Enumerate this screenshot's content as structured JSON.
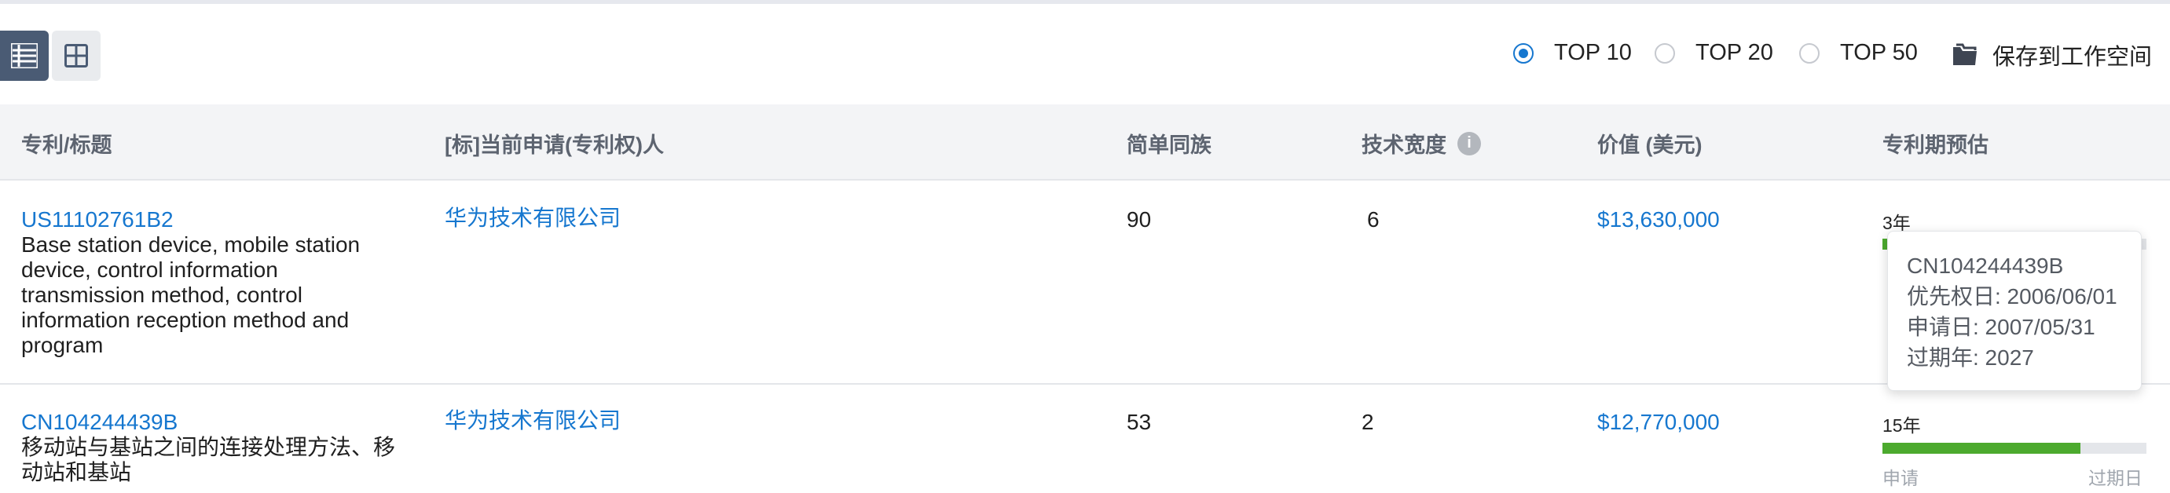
{
  "toolbar": {
    "view_list_icon": "list-view-icon",
    "view_grid_icon": "grid-view-icon",
    "top_options": [
      {
        "label": "TOP 10",
        "selected": true
      },
      {
        "label": "TOP 20",
        "selected": false
      },
      {
        "label": "TOP 50",
        "selected": false
      }
    ],
    "save_label": "保存到工作空间",
    "save_icon": "folder-icon"
  },
  "table": {
    "headers": {
      "patent_title": "专利/标题",
      "applicant": "[标]当前申请(专利权)人",
      "family": "简单同族",
      "tech_breadth": "技术宽度",
      "value": "价值 (美元)",
      "term": "专利期预估"
    },
    "rows": [
      {
        "patent_no": "US11102761B2",
        "title": "Base station device, mobile station device, control information transmission method, control information reception method and program",
        "applicant": "华为技术有限公司",
        "family": "90",
        "tech_breadth": "6",
        "value": "$13,630,000",
        "term_label": "3年",
        "term_progress": 0.2
      },
      {
        "patent_no": "CN104244439B",
        "title": "移动站与基站之间的连接处理方法、移动站和基站",
        "applicant": "华为技术有限公司",
        "family": "53",
        "tech_breadth": "2",
        "value": "$12,770,000",
        "term_label": "15年",
        "term_progress": 0.75,
        "bar_start_label": "申请",
        "bar_end_label": "过期日"
      }
    ]
  },
  "tooltip": {
    "patent_no": "CN104244439B",
    "priority_date": "优先权日: 2006/06/01",
    "filing_date": "申请日: 2007/05/31",
    "expiry_year": "过期年: 2027"
  },
  "colors": {
    "accent": "#1677cf",
    "progress": "#4caa2e",
    "active_view": "#4a5b74"
  }
}
